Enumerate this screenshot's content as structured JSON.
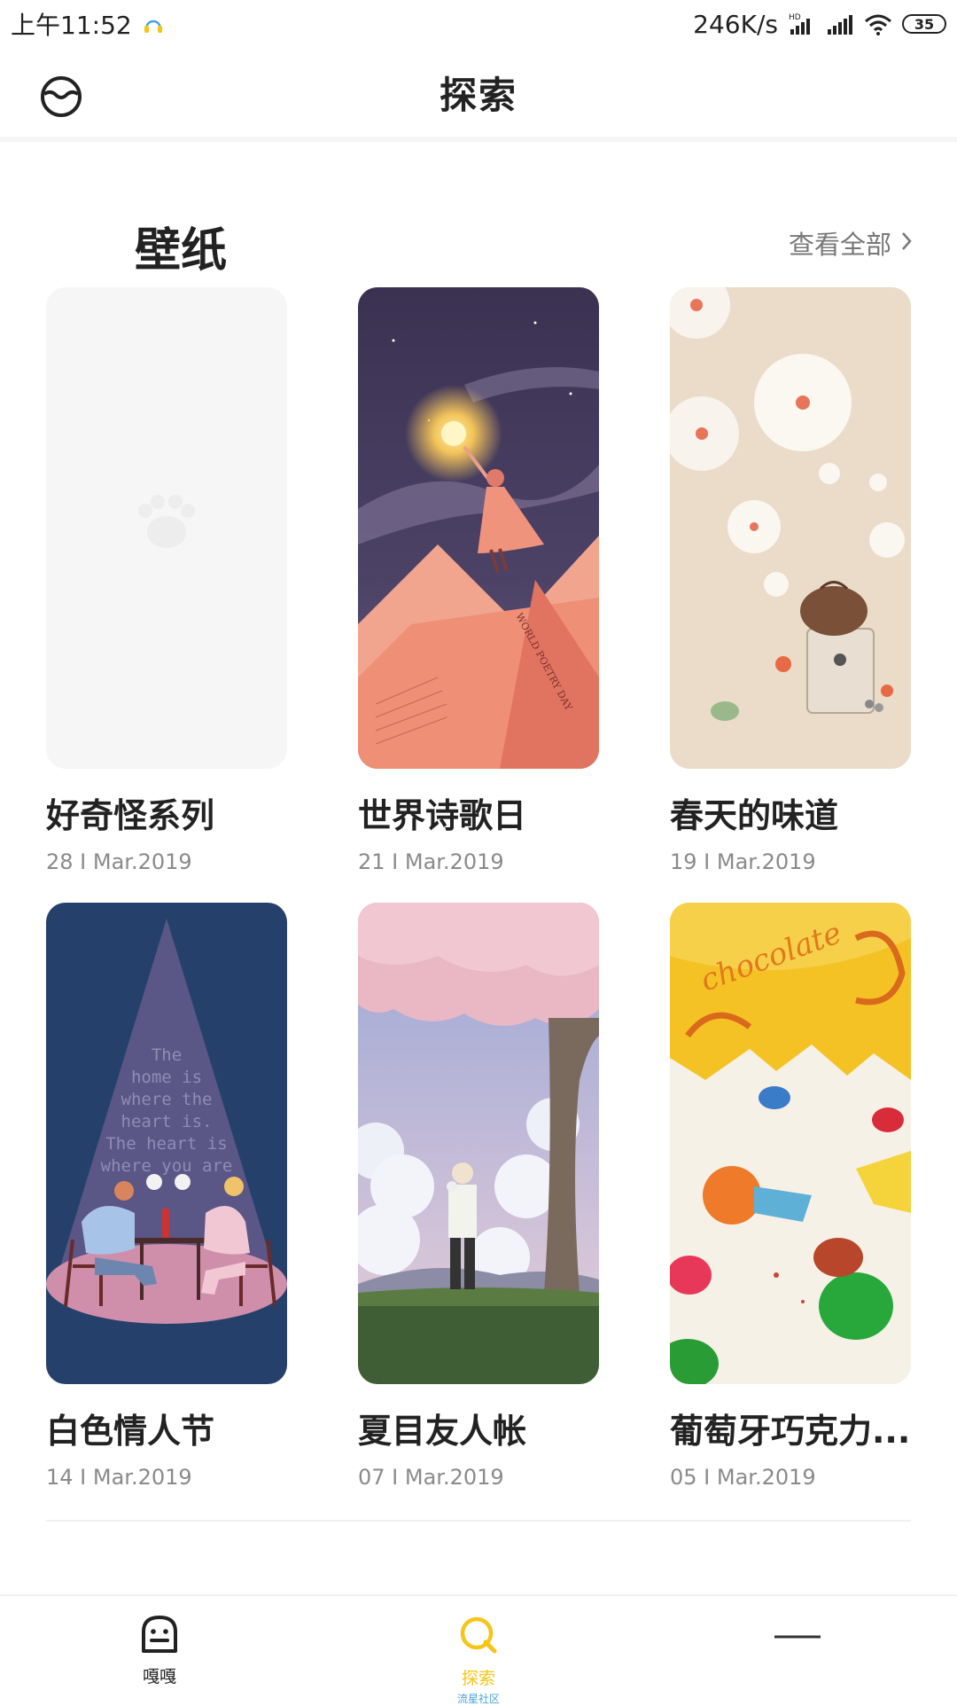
{
  "status_bar": {
    "time": "上午11:52",
    "network_speed": "246K/s",
    "hd_label": "HD",
    "battery": "35"
  },
  "header": {
    "title": "探索",
    "profile_icon": "face-avatar-icon"
  },
  "section": {
    "title": "壁纸",
    "view_all": "查看全部"
  },
  "cards": [
    {
      "title": "好奇怪系列",
      "date": "28 I Mar.2019"
    },
    {
      "title": "世界诗歌日",
      "date": "21 I Mar.2019"
    },
    {
      "title": "春天的味道",
      "date": "19 I Mar.2019"
    },
    {
      "title": "白色情人节",
      "date": "14 I Mar.2019"
    },
    {
      "title": "夏目友人帐",
      "date": "07 I Mar.2019"
    },
    {
      "title": "葡萄牙巧克力...",
      "date": "05 I Mar.2019"
    }
  ],
  "artwork_text": {
    "poetry_banner": "WORLD POETRY DAY",
    "valentine_lines": [
      "The",
      "home is",
      "where the",
      "heart is.",
      "The heart is",
      "where you are"
    ],
    "candy_wrapper": "chocolate"
  },
  "bottom_nav": {
    "items": [
      {
        "label": "嘎嘎",
        "icon": "face-icon"
      },
      {
        "label": "探索",
        "sub_label": "流星社区",
        "icon": "search-q-icon"
      },
      {
        "label": "",
        "icon": "menu-line-icon"
      }
    ]
  },
  "colors": {
    "accent": "#f5c518",
    "sub_label": "#4aa3df",
    "text_primary": "#222222",
    "text_secondary": "#8a8a8a"
  }
}
